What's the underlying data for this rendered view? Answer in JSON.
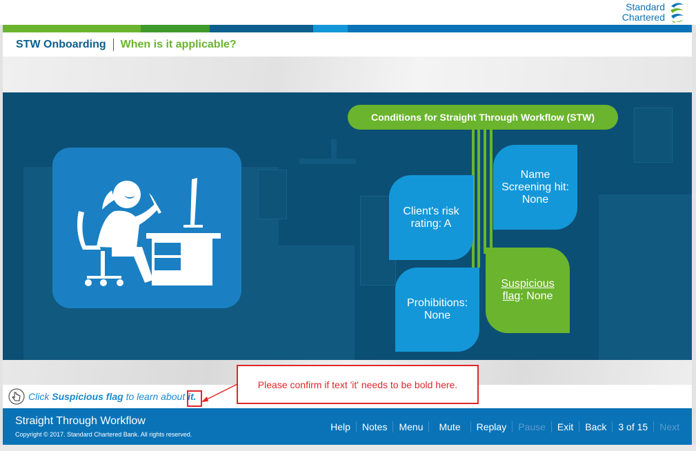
{
  "brand": {
    "line1": "Standard",
    "line2": "Chartered",
    "color": "#0a73b7",
    "accent": "#6bb42d"
  },
  "colorbar": [
    "#6bb42d",
    "#3f9a2b",
    "#0b5f8c",
    "#1497d8",
    "#0a73b7"
  ],
  "header": {
    "course_title": "STW Onboarding",
    "page_title": "When is it applicable?"
  },
  "slide": {
    "conditions_title": "Conditions for Straight Through Workflow (STW)",
    "conditions": {
      "risk": "Client's risk rating: A",
      "name_screening": "Name Screening hit: None",
      "prohibitions": "Prohibitions: None",
      "suspicious_link": "Suspicious flag",
      "suspicious_value": ": None"
    }
  },
  "instruction": {
    "pre": "Click",
    "bold": "Suspicious flag",
    "mid": "to learn about",
    "it": "it."
  },
  "callout": {
    "text": "Please confirm if text 'it' needs to be bold here."
  },
  "footer": {
    "title": "Straight Through Workflow",
    "copyright": "Copyright © 2017. Standard Chartered Bank. All rights reserved.",
    "nav": {
      "help": "Help",
      "notes": "Notes",
      "menu": "Menu",
      "mute": "Mute",
      "replay": "Replay",
      "pause": "Pause",
      "exit": "Exit",
      "back": "Back",
      "counter": "3 of 15",
      "next": "Next"
    }
  }
}
